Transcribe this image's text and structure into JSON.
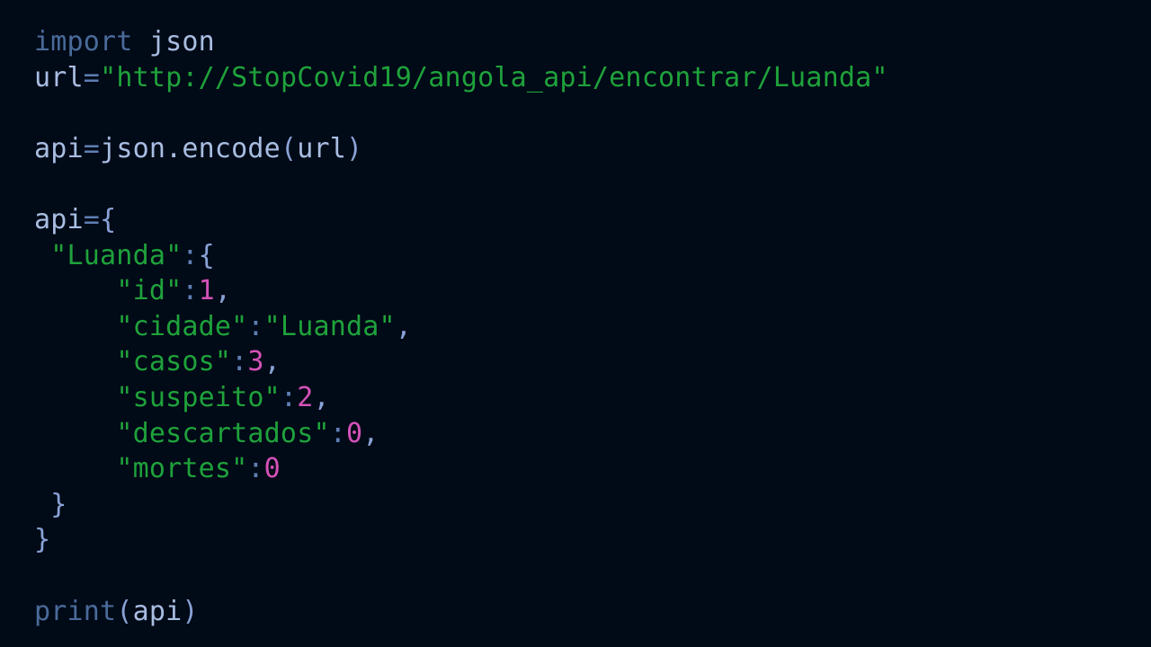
{
  "colors": {
    "background": "#010a17",
    "keyword": "#4a6b9a",
    "identifier": "#a9bde2",
    "operator": "#5f7fb4",
    "punctuation": "#8aa3d6",
    "string": "#1fa23b",
    "number": "#d452b8"
  },
  "code": {
    "lines": [
      [
        {
          "t": "import",
          "c": "kw"
        },
        {
          "t": " json",
          "c": "id"
        }
      ],
      [
        {
          "t": "url",
          "c": "id"
        },
        {
          "t": "=",
          "c": "op"
        },
        {
          "t": "\"http://StopCovid19/angola_api/encontrar/Luanda\"",
          "c": "str"
        }
      ],
      [],
      [
        {
          "t": "api",
          "c": "id"
        },
        {
          "t": "=",
          "c": "op"
        },
        {
          "t": "json.encode",
          "c": "id"
        },
        {
          "t": "(",
          "c": "pun"
        },
        {
          "t": "url",
          "c": "id"
        },
        {
          "t": ")",
          "c": "pun"
        }
      ],
      [],
      [
        {
          "t": "api",
          "c": "id"
        },
        {
          "t": "=",
          "c": "op"
        },
        {
          "t": "{",
          "c": "pun"
        }
      ],
      [
        {
          "t": " ",
          "c": "id"
        },
        {
          "t": "\"Luanda\"",
          "c": "str"
        },
        {
          "t": ":",
          "c": "op"
        },
        {
          "t": "{",
          "c": "pun"
        }
      ],
      [
        {
          "t": "     ",
          "c": "id"
        },
        {
          "t": "\"id\"",
          "c": "str"
        },
        {
          "t": ":",
          "c": "op"
        },
        {
          "t": "1",
          "c": "num"
        },
        {
          "t": ",",
          "c": "pun"
        }
      ],
      [
        {
          "t": "     ",
          "c": "id"
        },
        {
          "t": "\"cidade\"",
          "c": "str"
        },
        {
          "t": ":",
          "c": "op"
        },
        {
          "t": "\"Luanda\"",
          "c": "str"
        },
        {
          "t": ",",
          "c": "pun"
        }
      ],
      [
        {
          "t": "     ",
          "c": "id"
        },
        {
          "t": "\"casos\"",
          "c": "str"
        },
        {
          "t": ":",
          "c": "op"
        },
        {
          "t": "3",
          "c": "num"
        },
        {
          "t": ",",
          "c": "pun"
        }
      ],
      [
        {
          "t": "     ",
          "c": "id"
        },
        {
          "t": "\"suspeito\"",
          "c": "str"
        },
        {
          "t": ":",
          "c": "op"
        },
        {
          "t": "2",
          "c": "num"
        },
        {
          "t": ",",
          "c": "pun"
        }
      ],
      [
        {
          "t": "     ",
          "c": "id"
        },
        {
          "t": "\"descartados\"",
          "c": "str"
        },
        {
          "t": ":",
          "c": "op"
        },
        {
          "t": "0",
          "c": "num"
        },
        {
          "t": ",",
          "c": "pun"
        }
      ],
      [
        {
          "t": "     ",
          "c": "id"
        },
        {
          "t": "\"mortes\"",
          "c": "str"
        },
        {
          "t": ":",
          "c": "op"
        },
        {
          "t": "0",
          "c": "num"
        }
      ],
      [
        {
          "t": " ",
          "c": "id"
        },
        {
          "t": "}",
          "c": "pun"
        }
      ],
      [
        {
          "t": "}",
          "c": "pun"
        }
      ],
      [],
      [
        {
          "t": "print",
          "c": "kw"
        },
        {
          "t": "(",
          "c": "pun"
        },
        {
          "t": "api",
          "c": "id"
        },
        {
          "t": ")",
          "c": "pun"
        }
      ]
    ]
  }
}
